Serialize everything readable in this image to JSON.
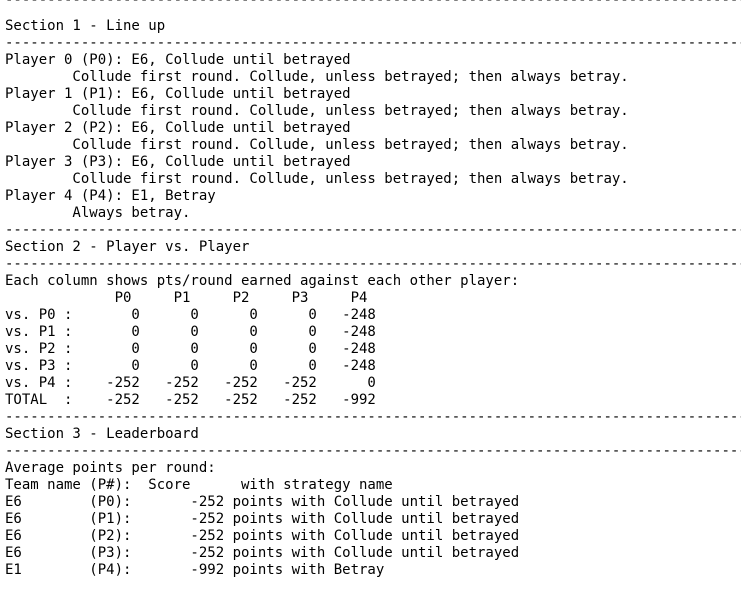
{
  "separator": "----------------------------------------------------------------------------------------------------",
  "section1": {
    "title": "Section 1 - Line up",
    "players": [
      {
        "header": "Player 0 (P0): E6, Collude until betrayed",
        "description": "        Collude first round. Collude, unless betrayed; then always betray."
      },
      {
        "header": "Player 1 (P1): E6, Collude until betrayed",
        "description": "        Collude first round. Collude, unless betrayed; then always betray."
      },
      {
        "header": "Player 2 (P2): E6, Collude until betrayed",
        "description": "        Collude first round. Collude, unless betrayed; then always betray."
      },
      {
        "header": "Player 3 (P3): E6, Collude until betrayed",
        "description": "        Collude first round. Collude, unless betrayed; then always betray."
      },
      {
        "header": "Player 4 (P4): E1, Betray",
        "description": "        Always betray."
      }
    ]
  },
  "section2": {
    "title": "Section 2 - Player vs. Player",
    "intro": "Each column shows pts/round earned against each other player:",
    "column_header": "             P0     P1     P2     P3     P4",
    "rows": [
      "vs. P0 :       0      0      0      0   -248",
      "vs. P1 :       0      0      0      0   -248",
      "vs. P2 :       0      0      0      0   -248",
      "vs. P3 :       0      0      0      0   -248",
      "vs. P4 :    -252   -252   -252   -252      0",
      "TOTAL  :    -252   -252   -252   -252   -992"
    ]
  },
  "section3": {
    "title": "Section 3 - Leaderboard",
    "intro": "Average points per round:",
    "column_header": "Team name (P#):  Score      with strategy name",
    "rows": [
      "E6        (P0):       -252 points with Collude until betrayed",
      "E6        (P1):       -252 points with Collude until betrayed",
      "E6        (P2):       -252 points with Collude until betrayed",
      "E6        (P3):       -252 points with Collude until betrayed",
      "E1        (P4):       -992 points with Betray"
    ]
  }
}
